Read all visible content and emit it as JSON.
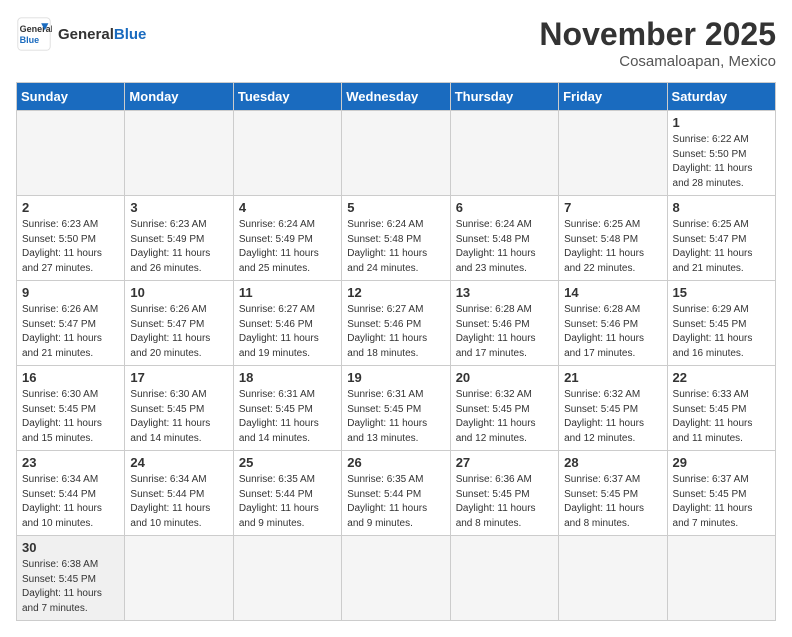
{
  "logo": {
    "text_general": "General",
    "text_blue": "Blue"
  },
  "header": {
    "month": "November 2025",
    "location": "Cosamaloapan, Mexico"
  },
  "weekdays": [
    "Sunday",
    "Monday",
    "Tuesday",
    "Wednesday",
    "Thursday",
    "Friday",
    "Saturday"
  ],
  "weeks": [
    [
      {
        "day": "",
        "info": ""
      },
      {
        "day": "",
        "info": ""
      },
      {
        "day": "",
        "info": ""
      },
      {
        "day": "",
        "info": ""
      },
      {
        "day": "",
        "info": ""
      },
      {
        "day": "",
        "info": ""
      },
      {
        "day": "1",
        "info": "Sunrise: 6:22 AM\nSunset: 5:50 PM\nDaylight: 11 hours and 28 minutes."
      }
    ],
    [
      {
        "day": "2",
        "info": "Sunrise: 6:23 AM\nSunset: 5:50 PM\nDaylight: 11 hours and 27 minutes."
      },
      {
        "day": "3",
        "info": "Sunrise: 6:23 AM\nSunset: 5:49 PM\nDaylight: 11 hours and 26 minutes."
      },
      {
        "day": "4",
        "info": "Sunrise: 6:24 AM\nSunset: 5:49 PM\nDaylight: 11 hours and 25 minutes."
      },
      {
        "day": "5",
        "info": "Sunrise: 6:24 AM\nSunset: 5:48 PM\nDaylight: 11 hours and 24 minutes."
      },
      {
        "day": "6",
        "info": "Sunrise: 6:24 AM\nSunset: 5:48 PM\nDaylight: 11 hours and 23 minutes."
      },
      {
        "day": "7",
        "info": "Sunrise: 6:25 AM\nSunset: 5:48 PM\nDaylight: 11 hours and 22 minutes."
      },
      {
        "day": "8",
        "info": "Sunrise: 6:25 AM\nSunset: 5:47 PM\nDaylight: 11 hours and 21 minutes."
      }
    ],
    [
      {
        "day": "9",
        "info": "Sunrise: 6:26 AM\nSunset: 5:47 PM\nDaylight: 11 hours and 21 minutes."
      },
      {
        "day": "10",
        "info": "Sunrise: 6:26 AM\nSunset: 5:47 PM\nDaylight: 11 hours and 20 minutes."
      },
      {
        "day": "11",
        "info": "Sunrise: 6:27 AM\nSunset: 5:46 PM\nDaylight: 11 hours and 19 minutes."
      },
      {
        "day": "12",
        "info": "Sunrise: 6:27 AM\nSunset: 5:46 PM\nDaylight: 11 hours and 18 minutes."
      },
      {
        "day": "13",
        "info": "Sunrise: 6:28 AM\nSunset: 5:46 PM\nDaylight: 11 hours and 17 minutes."
      },
      {
        "day": "14",
        "info": "Sunrise: 6:28 AM\nSunset: 5:46 PM\nDaylight: 11 hours and 17 minutes."
      },
      {
        "day": "15",
        "info": "Sunrise: 6:29 AM\nSunset: 5:45 PM\nDaylight: 11 hours and 16 minutes."
      }
    ],
    [
      {
        "day": "16",
        "info": "Sunrise: 6:30 AM\nSunset: 5:45 PM\nDaylight: 11 hours and 15 minutes."
      },
      {
        "day": "17",
        "info": "Sunrise: 6:30 AM\nSunset: 5:45 PM\nDaylight: 11 hours and 14 minutes."
      },
      {
        "day": "18",
        "info": "Sunrise: 6:31 AM\nSunset: 5:45 PM\nDaylight: 11 hours and 14 minutes."
      },
      {
        "day": "19",
        "info": "Sunrise: 6:31 AM\nSunset: 5:45 PM\nDaylight: 11 hours and 13 minutes."
      },
      {
        "day": "20",
        "info": "Sunrise: 6:32 AM\nSunset: 5:45 PM\nDaylight: 11 hours and 12 minutes."
      },
      {
        "day": "21",
        "info": "Sunrise: 6:32 AM\nSunset: 5:45 PM\nDaylight: 11 hours and 12 minutes."
      },
      {
        "day": "22",
        "info": "Sunrise: 6:33 AM\nSunset: 5:45 PM\nDaylight: 11 hours and 11 minutes."
      }
    ],
    [
      {
        "day": "23",
        "info": "Sunrise: 6:34 AM\nSunset: 5:44 PM\nDaylight: 11 hours and 10 minutes."
      },
      {
        "day": "24",
        "info": "Sunrise: 6:34 AM\nSunset: 5:44 PM\nDaylight: 11 hours and 10 minutes."
      },
      {
        "day": "25",
        "info": "Sunrise: 6:35 AM\nSunset: 5:44 PM\nDaylight: 11 hours and 9 minutes."
      },
      {
        "day": "26",
        "info": "Sunrise: 6:35 AM\nSunset: 5:44 PM\nDaylight: 11 hours and 9 minutes."
      },
      {
        "day": "27",
        "info": "Sunrise: 6:36 AM\nSunset: 5:45 PM\nDaylight: 11 hours and 8 minutes."
      },
      {
        "day": "28",
        "info": "Sunrise: 6:37 AM\nSunset: 5:45 PM\nDaylight: 11 hours and 8 minutes."
      },
      {
        "day": "29",
        "info": "Sunrise: 6:37 AM\nSunset: 5:45 PM\nDaylight: 11 hours and 7 minutes."
      }
    ],
    [
      {
        "day": "30",
        "info": "Sunrise: 6:38 AM\nSunset: 5:45 PM\nDaylight: 11 hours and 7 minutes."
      },
      {
        "day": "",
        "info": ""
      },
      {
        "day": "",
        "info": ""
      },
      {
        "day": "",
        "info": ""
      },
      {
        "day": "",
        "info": ""
      },
      {
        "day": "",
        "info": ""
      },
      {
        "day": "",
        "info": ""
      }
    ]
  ]
}
